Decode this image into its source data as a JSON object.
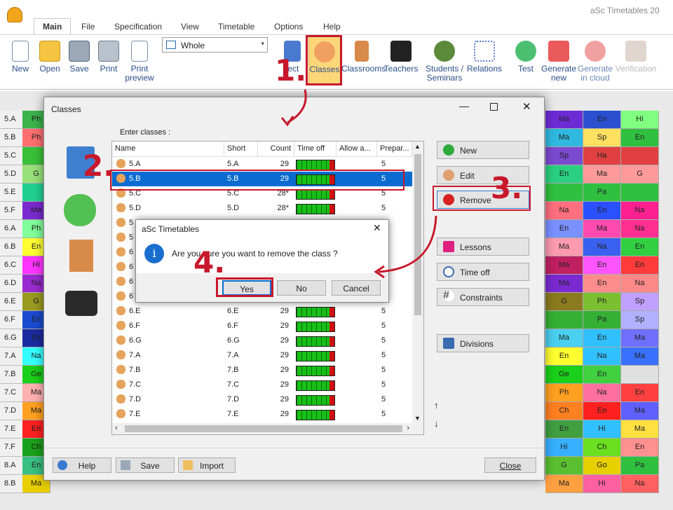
{
  "app": {
    "title": "aSc Timetables 20"
  },
  "tabs": [
    "Main",
    "File",
    "Specification",
    "View",
    "Timetable",
    "Options",
    "Help"
  ],
  "ribbon": {
    "new": "New",
    "open": "Open",
    "save": "Save",
    "print": "Print",
    "print_preview_1": "Print",
    "print_preview_2": "preview",
    "view_select": "Whole",
    "subjects": "ject",
    "classes": "Classes",
    "classrooms": "Classrooms",
    "teachers": "Teachers",
    "students_1": "Students /",
    "students_2": "Seminars",
    "relations": "Relations",
    "test": "Test",
    "generate_new_1": "Generate",
    "generate_new_2": "new",
    "generate_cloud_1": "Generate",
    "generate_cloud_2": "in cloud",
    "verification": "Verification"
  },
  "grid": {
    "rows": [
      "5.A",
      "5.B",
      "5.C",
      "5.D",
      "5.E",
      "5.F",
      "6.A",
      "6.B",
      "6.C",
      "6.D",
      "6.E",
      "6.F",
      "6.G",
      "7.A",
      "7.B",
      "7.C",
      "7.D",
      "7.E",
      "7.F",
      "8.A",
      "8.B"
    ],
    "left_cells": [
      "Ph",
      "Ph",
      "",
      "G",
      "",
      "Ma",
      "Ph",
      "En",
      "Hi",
      "Na",
      "G",
      "En",
      "En",
      "Na",
      "Ge",
      "Ma",
      "Ma",
      "En",
      "Ch",
      "En",
      "Ma"
    ],
    "left_colors": [
      "#3cb34b",
      "#ff6f6f",
      "#39c039",
      "#98e07a",
      "#20d090",
      "#7a2ad0",
      "#80ff9a",
      "#ffff33",
      "#ff33ff",
      "#9a2ad0",
      "#9a9a20",
      "#1a4ad0",
      "#1a2aa0",
      "#33ffff",
      "#1ad01a",
      "#ffb0b0",
      "#ffa020",
      "#ff2020",
      "#1aa01a",
      "#39c080",
      "#e8cf00"
    ],
    "right_a": [
      "Ma",
      "Ma",
      "Sp",
      "En",
      "",
      "Na",
      "En",
      "Ma",
      "Ma",
      "Ma",
      "G",
      "",
      "Ma",
      "En",
      "Ge",
      "Ph",
      "Ch",
      "En",
      "Hi",
      "G",
      "Ma"
    ],
    "right_b": [
      "En",
      "Sp",
      "Ha",
      "Ma",
      "Pa",
      "En",
      "Ma",
      "Na",
      "En",
      "En",
      "Ph",
      "Pa",
      "En",
      "Na",
      "En",
      "Na",
      "En",
      "Hi",
      "Ch",
      "Go",
      "Hi"
    ],
    "right_c": [
      "Hi",
      "En",
      "",
      "G",
      "",
      "Na",
      "Na",
      "En",
      "En",
      "Na",
      "Sp",
      "Sp",
      "Ma",
      "Ma",
      "",
      "En",
      "Ma",
      "Ma",
      "En",
      "Pa",
      "Na"
    ],
    "right_colors_a": [
      "#6d2bd5",
      "#2fb8e0",
      "#7c4ad0",
      "#2ad080",
      "#30c040",
      "#ff6f7f",
      "#7a90ff",
      "#ff9ab0",
      "#c02060",
      "#7a2ad0",
      "#8a7a20",
      "#35b035",
      "#4ad0f0",
      "#ffff30",
      "#1ad01a",
      "#ffa020",
      "#ff8020",
      "#40a040",
      "#36b0ff",
      "#5ac030",
      "#ffa040"
    ],
    "right_colors_b": [
      "#2a50d0",
      "#ffe060",
      "#e04040",
      "#ff9a9a",
      "#30c040",
      "#2a50ff",
      "#ff4ab0",
      "#3a60f0",
      "#ff55ff",
      "#ff8c8c",
      "#7ac030",
      "#35b035",
      "#30c0ff",
      "#30c0ff",
      "#40d040",
      "#ff70a0",
      "#ff2020",
      "#30c0ff",
      "#6ae020",
      "#e8cf00",
      "#ff60a0"
    ],
    "right_colors_c": [
      "#80ff80",
      "#30c040",
      "#e04040",
      "#ff9a9a",
      "#30c040",
      "#ff2090",
      "#ff3090",
      "#30d040",
      "#ff3a3a",
      "#ff8888",
      "#c0a0ff",
      "#b0b0ff",
      "#7070ff",
      "#3a70ff",
      "#e0e0e0",
      "#ff4040",
      "#6060ff",
      "#ffe040",
      "#ff9090",
      "#30c040",
      "#ff6060"
    ]
  },
  "dialog": {
    "title": "Classes",
    "enter_label": "Enter classes :",
    "columns": [
      "Name",
      "Short",
      "Count",
      "Time off",
      "Allow a...",
      "Prepar..."
    ],
    "rows": [
      {
        "name": "5.A",
        "short": "5.A",
        "count": "29",
        "prep": "5"
      },
      {
        "name": "5.B",
        "short": "5.B",
        "count": "29",
        "prep": "5"
      },
      {
        "name": "5.C",
        "short": "5.C",
        "count": "28*",
        "prep": "5"
      },
      {
        "name": "5.D",
        "short": "5.D",
        "count": "28*",
        "prep": "5"
      },
      {
        "name": "5",
        "short": "",
        "count": "",
        "prep": ""
      },
      {
        "name": "5",
        "short": "",
        "count": "",
        "prep": ""
      },
      {
        "name": "6",
        "short": "",
        "count": "",
        "prep": ""
      },
      {
        "name": "6",
        "short": "",
        "count": "",
        "prep": ""
      },
      {
        "name": "6",
        "short": "",
        "count": "",
        "prep": ""
      },
      {
        "name": "6",
        "short": "",
        "count": "",
        "prep": ""
      },
      {
        "name": "6.E",
        "short": "6.E",
        "count": "29",
        "prep": "5"
      },
      {
        "name": "6.F",
        "short": "6.F",
        "count": "29",
        "prep": "5"
      },
      {
        "name": "6.G",
        "short": "6.G",
        "count": "29",
        "prep": "5"
      },
      {
        "name": "7.A",
        "short": "7.A",
        "count": "29",
        "prep": "5"
      },
      {
        "name": "7.B",
        "short": "7.B",
        "count": "29",
        "prep": "5"
      },
      {
        "name": "7.C",
        "short": "7.C",
        "count": "29",
        "prep": "5"
      },
      {
        "name": "7.D",
        "short": "7.D",
        "count": "29",
        "prep": "5"
      },
      {
        "name": "7.E",
        "short": "7.E",
        "count": "29",
        "prep": "5"
      }
    ],
    "buttons": {
      "new": "New",
      "edit": "Edit",
      "remove": "Remove",
      "lessons": "Lessons",
      "time_off": "Time off",
      "constraints": "Constraints",
      "divisions": "Divisions",
      "help": "Help",
      "save": "Save",
      "import": "Import",
      "close": "Close"
    }
  },
  "message": {
    "title": "aSc Timetables",
    "text": "Are you sure you want to remove the class ?",
    "yes": "Yes",
    "no": "No",
    "cancel": "Cancel"
  },
  "annotations": {
    "n1": "1.",
    "n2": "2.",
    "n3": "3.",
    "n4": "4."
  },
  "colors": {
    "accent": "#c8182b",
    "selected": "#0a6cd0",
    "timeoff_green": "#17c017"
  }
}
